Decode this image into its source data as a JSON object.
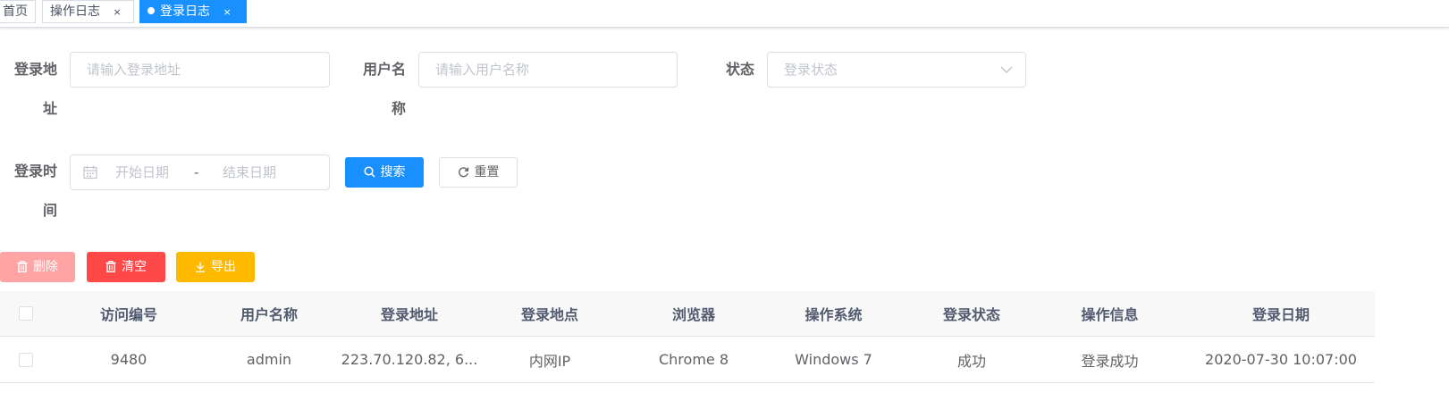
{
  "tabs": [
    {
      "label": "首页"
    },
    {
      "label": "操作日志",
      "close": "×"
    },
    {
      "label": "登录日志",
      "close": "×"
    }
  ],
  "form": {
    "ipaddr": {
      "label_line1": "登录地",
      "label_line2": "址",
      "placeholder": "请输入登录地址"
    },
    "username": {
      "label_line1": "用户名",
      "label_line2": "称",
      "placeholder": "请输入用户名称"
    },
    "status": {
      "label": "状态",
      "placeholder": "登录状态"
    },
    "login_time": {
      "label_line1": "登录时",
      "label_line2": "间",
      "start_placeholder": "开始日期",
      "separator": "-",
      "end_placeholder": "结束日期"
    },
    "search_label": "搜索",
    "reset_label": "重置"
  },
  "toolbar": {
    "delete_label": "删除",
    "clean_label": "清空",
    "export_label": "导出"
  },
  "table": {
    "columns": [
      "访问编号",
      "用户名称",
      "登录地址",
      "登录地点",
      "浏览器",
      "操作系统",
      "登录状态",
      "操作信息",
      "登录日期"
    ],
    "rows": [
      [
        "9480",
        "admin",
        "223.70.120.82, 6...",
        "内网IP",
        "Chrome 8",
        "Windows 7",
        "成功",
        "登录成功",
        "2020-07-30 10:07:00"
      ]
    ]
  },
  "colors": {
    "primary": "#1890ff",
    "danger": "#ff4949",
    "danger_disabled": "#ffa4a4",
    "warning": "#ffba00"
  },
  "icons": [
    "close-icon",
    "chevron-down-icon",
    "calendar-icon",
    "search-icon",
    "refresh-icon",
    "delete-icon",
    "download-icon"
  ]
}
